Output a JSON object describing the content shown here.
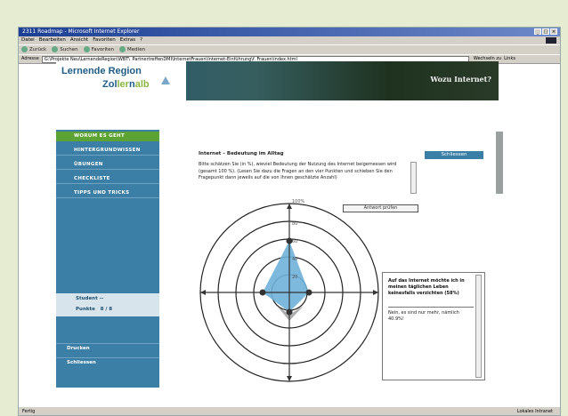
{
  "browser": {
    "title": "2311 Roadmap - Microsoft Internet Explorer",
    "menu": [
      "Datei",
      "Bearbeiten",
      "Ansicht",
      "Favoriten",
      "Extras",
      "?"
    ],
    "toolbar": [
      "Zurück",
      "Suchen",
      "Favoriten",
      "Medien"
    ],
    "address_label": "Adresse",
    "address_value": "G:\\Projekte Neu\\LernendeRegion\\WBT\\_PartnertreffenDMI\\InternetFrauen\\Internet-Einführung\\f. Frauen\\index.html",
    "go_label": "Wechseln zu",
    "links_label": "Links",
    "status_left": "Fertig",
    "status_right": "Lokales Intranet"
  },
  "banner": {
    "logo_line1": "Lernende Region",
    "logo_line2_a": "Zol",
    "logo_line2_b": "ler",
    "logo_line2_c": "n",
    "logo_line2_d": "alb",
    "heading": "Wozu Internet?"
  },
  "nav": {
    "items": [
      {
        "label": "WORUM ES GEHT"
      },
      {
        "label": "HINTERGRUNDWISSEN"
      },
      {
        "label": "ÜBUNGEN"
      },
      {
        "label": "CHECKLISTE"
      },
      {
        "label": "TIPPS UND TRICKS"
      }
    ],
    "user_label": "Student",
    "user_value": "--",
    "points_label": "Punkte",
    "points_value": "8 / 8",
    "print_label": "Drucken",
    "close_label": "Schliessen"
  },
  "content": {
    "title": "Internet – Bedeutung im Alltag",
    "description": "Bitte schätzen Sie (in %), wieviel Bedeutung der Nutzung des Internet beigemessen wird (gesamt 100 %). (Lesen Sie dazu die Fragen an den vier Punkten und schieben Sie den Fragepunkt dann jeweils auf die von Ihnen geschätzte Anzahl)",
    "close_button": "Schliessen",
    "check_button": "Antwort prüfen",
    "scale_labels": [
      "100%",
      "80",
      "60",
      "40",
      "20"
    ],
    "answer_heading": "Auf das Internet möchte ich in meinen täglichen Leben keinesfalls verzichten (58%)",
    "answer_body": "Nein, es sind nur mehr, nämlich 40.9%!"
  },
  "colors": {
    "nav_blue": "#3c7fa6",
    "active_green": "#5da333",
    "radar_fill": "#6fb1d9"
  }
}
